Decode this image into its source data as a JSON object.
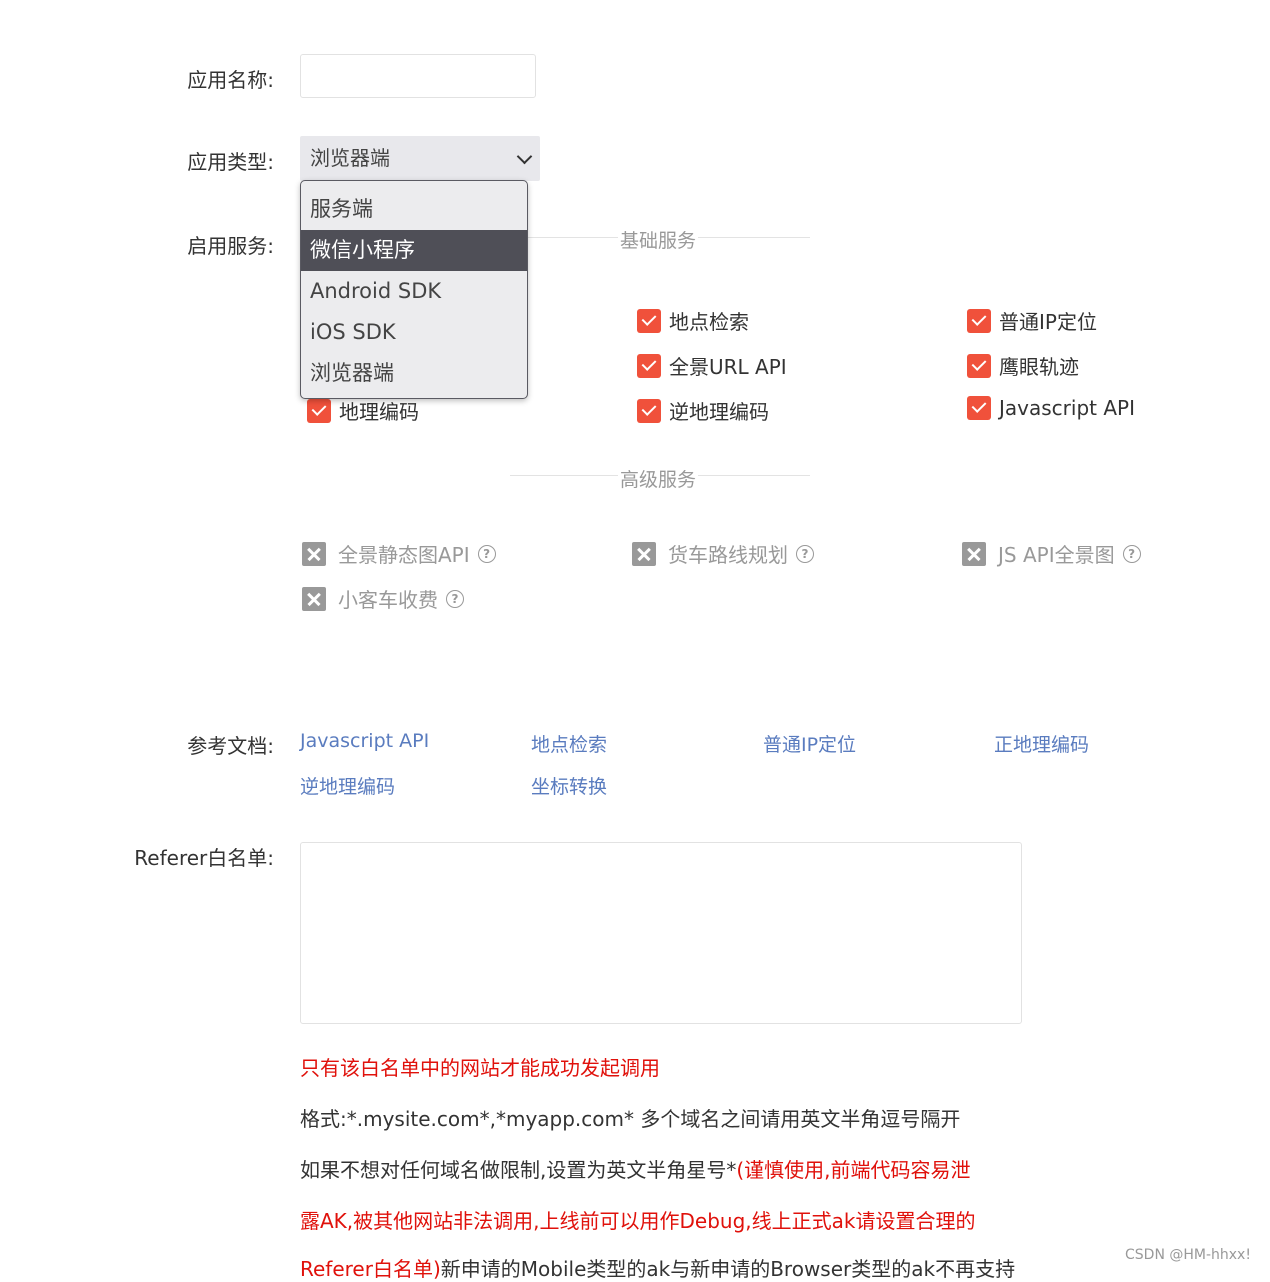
{
  "form": {
    "app_name_label": "应用名称:",
    "app_name_value": "",
    "app_type_label": "应用类型:",
    "app_type_selected": "浏览器端",
    "services_label": "启用服务:"
  },
  "dropdown": {
    "options": [
      "服务端",
      "微信小程序",
      "Android SDK",
      "iOS SDK",
      "浏览器端"
    ],
    "highlighted": "微信小程序"
  },
  "basic": {
    "title": "基础服务",
    "items": [
      "地理编码",
      "地点检索",
      "全景URL API",
      "逆地理编码",
      "普通IP定位",
      "鹰眼轨迹",
      "Javascript API"
    ]
  },
  "advanced": {
    "title": "高级服务",
    "items": [
      "全景静态图API",
      "货车路线规划",
      "JS API全景图",
      "小客车收费"
    ],
    "help_glyph": "?"
  },
  "docs": {
    "label": "参考文档:",
    "links": [
      "Javascript API",
      "地点检索",
      "普通IP定位",
      "正地理编码",
      "逆地理编码",
      "坐标转换"
    ]
  },
  "referer": {
    "label": "Referer白名单:",
    "value": "",
    "note1": "只有该白名单中的网站才能成功发起调用",
    "note2": "格式:*.mysite.com*,*myapp.com* 多个域名之间请用英文半角逗号隔开",
    "note3_a": "如果不想对任何域名做限制,设置为英文半角星号*",
    "note3_b": "(谨慎使用,前端代码容易泄",
    "note4": "露AK,被其他网站非法调用,上线前可以用作Debug,线上正式ak请设置合理的",
    "note5_a": "Referer白名单)",
    "note5_b": "新申请的Mobile类型的ak与新申请的Browser类型的ak不再支持"
  },
  "watermark": "CSDN @HM-hhxx!",
  "colors": {
    "accent": "#f0513b",
    "link": "#5a7cbf",
    "warning": "#e0110b"
  }
}
